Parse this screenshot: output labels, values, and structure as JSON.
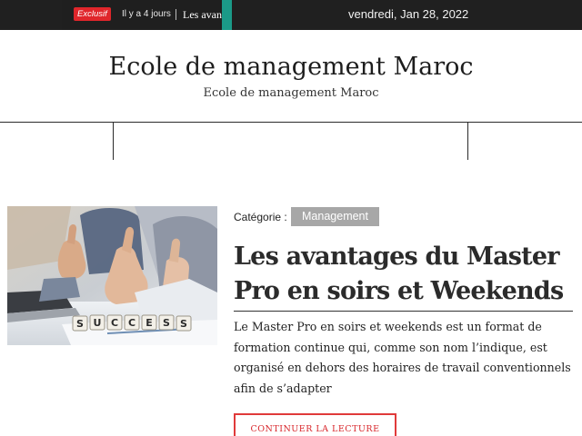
{
  "topbar": {
    "badge": "Exclusif",
    "time_ago": "Il y a 4 jours",
    "ticker_text": "Les avantages du Master Pro en soirs et Weekends",
    "date": "vendredi, Jan 28, 2022"
  },
  "header": {
    "site_title": "Ecole de management Maroc",
    "site_description": "Ecole de management Maroc"
  },
  "post": {
    "image_tiles": [
      "S",
      "U",
      "C",
      "C",
      "E",
      "S",
      "S"
    ],
    "category_label": "Catégorie :",
    "category": "Management",
    "title": "Les avantages du Master Pro en soirs et Weekends",
    "excerpt": "Le Master Pro en soirs et weekends est un format de formation continue qui, comme son nom l’indique, est organisé en dehors des horaires de travail conventionnels afin de s’adapter",
    "read_more": "CONTINUER LA LECTURE"
  },
  "colors": {
    "topbar_bg": "#202020",
    "badge_red": "#e0262b",
    "accent_teal": "#1b9a88",
    "chip_grey": "#a7a7a7",
    "button_red": "#d8262b"
  }
}
